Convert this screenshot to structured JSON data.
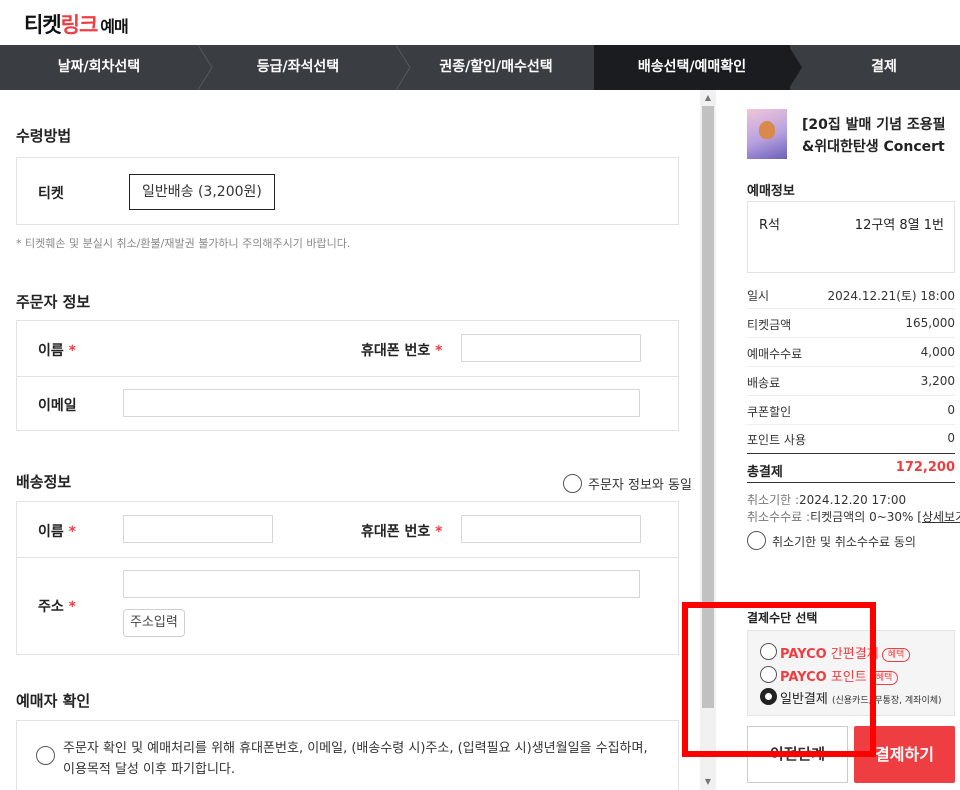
{
  "header": {
    "logo_part1": "티켓",
    "logo_part2": "링크",
    "logo_sub": "예매"
  },
  "steps": [
    "날짜/회차선택",
    "등급/좌석선택",
    "권종/할인/매수선택",
    "배송선택/예매확인",
    "결제"
  ],
  "receive": {
    "title": "수령방법",
    "ticket_label": "티켓",
    "delivery_option": "일반배송 (3,200원)",
    "note": "* 티켓훼손 및 분실시 취소/환불/재발권 불가하니 주의해주시기 바랍니다."
  },
  "orderer": {
    "title": "주문자 정보",
    "name_label": "이름",
    "phone_label": "휴대폰 번호",
    "email_label": "이메일",
    "required_mark": "*"
  },
  "shipping": {
    "title": "배송정보",
    "same_label": "주문자 정보와 동일",
    "name_label": "이름",
    "phone_label": "휴대폰 번호",
    "address_label": "주소",
    "address_button": "주소입력",
    "required_mark": "*"
  },
  "booker": {
    "title": "예매자 확인",
    "consent_line1": "주문자 확인 및 예매처리를 위해 휴대폰번호, 이메일, (배송수령 시)주소, (입력필요 시)생년월일을 수집하며,",
    "consent_line2": "이용목적 달성 이후 파기합니다."
  },
  "summary": {
    "product_line1": "[20집 발매 기념 조용필",
    "product_line2": "&위대한탄생 Concert",
    "booking_title": "예매정보",
    "seat_grade": "R석",
    "seat_info": "12구역 8열 1번",
    "rows": [
      {
        "k": "일시",
        "v": "2024.12.21(토) 18:00"
      },
      {
        "k": "티켓금액",
        "v": "165,000"
      },
      {
        "k": "예매수수료",
        "v": "4,000"
      },
      {
        "k": "배송료",
        "v": "3,200"
      },
      {
        "k": "쿠폰할인",
        "v": "0"
      },
      {
        "k": "포인트 사용",
        "v": "0"
      }
    ],
    "total_label": "총결제",
    "total_value": "172,200",
    "cancel_deadline_label": "취소기한 :",
    "cancel_deadline": "2024.12.20 17:00",
    "cancel_fee_label": "취소수수료 :",
    "cancel_fee": "티켓금액의 0~30%",
    "cancel_detail": "[상세보기]",
    "agree_label": "취소기한 및 취소수수료 동의"
  },
  "payment": {
    "title": "결제수단 선택",
    "payco_brand": "PAYCO",
    "easy_label": "간편결제",
    "point_label": "포인트",
    "benefit_badge": "혜택",
    "general_label": "일반결제",
    "general_sub": "(신용카드, 무통장, 계좌이체)",
    "prev_button": "이전단계",
    "pay_button": "결제하기"
  },
  "colors": {
    "accent": "#ef3e42",
    "step_bar": "#3a3d42",
    "step_active": "#1b1c1f"
  }
}
